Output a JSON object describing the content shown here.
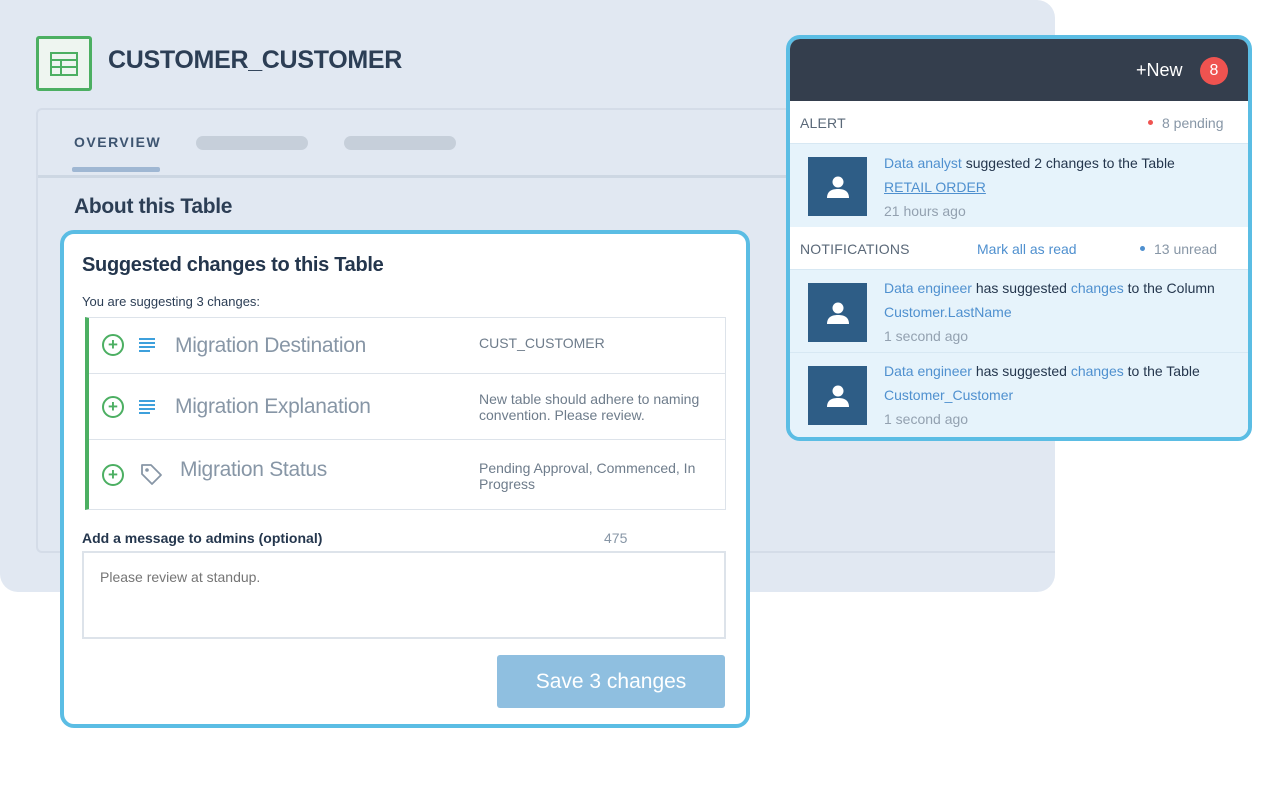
{
  "table": {
    "title": "CUSTOMER_CUSTOMER",
    "icon": "table-icon"
  },
  "tabs": {
    "overview": "OVERVIEW"
  },
  "about_title": "About this Table",
  "suggest": {
    "title": "Suggested changes to this Table",
    "subtitle": "You are suggesting 3 changes:",
    "rows": [
      {
        "label": "Migration Destination",
        "value": "CUST_CUSTOMER",
        "icon": "text-lines-icon"
      },
      {
        "label": "Migration Explanation",
        "value": "New table should adhere to naming convention. Please review.",
        "icon": "text-lines-icon"
      },
      {
        "label": "Migration Status",
        "value": "Pending Approval, Commenced, In Progress",
        "icon": "tag-icon"
      }
    ],
    "message_label": "Add a message to admins (optional)",
    "message_count": "475",
    "message_placeholder": "Please review at standup.",
    "save_label": "Save 3 changes"
  },
  "notifications": {
    "new_label": "+New",
    "badge": "8",
    "alert": {
      "label": "ALERT",
      "pending": "8 pending",
      "item": {
        "actor": "Data analyst",
        "text": " suggested 2 changes to the Table",
        "target": "RETAIL ORDER",
        "time": "21 hours ago"
      }
    },
    "notif": {
      "label": "NOTIFICATIONS",
      "mark_all": "Mark all as read",
      "unread": "13 unread",
      "items": [
        {
          "actor": "Data engineer",
          "mid": " has suggested ",
          "link": "changes",
          "tail": " to the Column",
          "target": "Customer.LastName",
          "time": "1 second ago"
        },
        {
          "actor": "Data engineer",
          "mid": " has suggested ",
          "link": "changes",
          "tail": " to the Table",
          "target": "Customer_Customer",
          "time": "1 second ago"
        }
      ]
    }
  },
  "colors": {
    "accent_border": "#5bbde4",
    "success_green": "#4caf62",
    "badge_red": "#ef5350",
    "link_blue": "#4f90cf",
    "avatar_navy": "#2e5d86",
    "header_dark": "#343e4d"
  }
}
